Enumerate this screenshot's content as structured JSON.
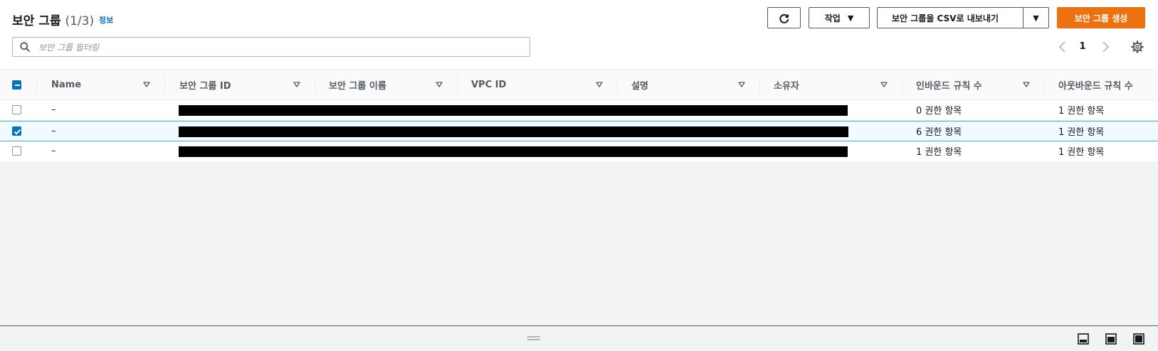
{
  "header": {
    "title": "보안 그룹",
    "count": "(1/3)",
    "info_link": "정보"
  },
  "toolbar": {
    "refresh_icon": "refresh-icon",
    "actions_label": "작업",
    "export_label": "보안 그룹을 CSV로 내보내기",
    "create_label": "보안 그룹 생성"
  },
  "search": {
    "placeholder": "보안 그룹 필터링",
    "value": ""
  },
  "pagination": {
    "current_page": "1"
  },
  "table": {
    "columns": [
      "Name",
      "보안 그룹 ID",
      "보안 그룹 이름",
      "VPC ID",
      "설명",
      "소유자",
      "인바운드 규칙 수",
      "아웃바운드 규칙 수"
    ],
    "rows": [
      {
        "selected": false,
        "name": "–",
        "inbound": "0 권한 항목",
        "outbound": "1 권한 항목"
      },
      {
        "selected": true,
        "name": "–",
        "inbound": "6 권한 항목",
        "outbound": "1 권한 항목"
      },
      {
        "selected": false,
        "name": "–",
        "inbound": "1 권한 항목",
        "outbound": "1 권한 항목"
      }
    ]
  },
  "colors": {
    "primary_button": "#ec7211",
    "link": "#0073bb",
    "checkbox_checked": "#0073bb",
    "selected_row_bg": "#f1faff",
    "selected_row_border": "#44b9d6"
  }
}
